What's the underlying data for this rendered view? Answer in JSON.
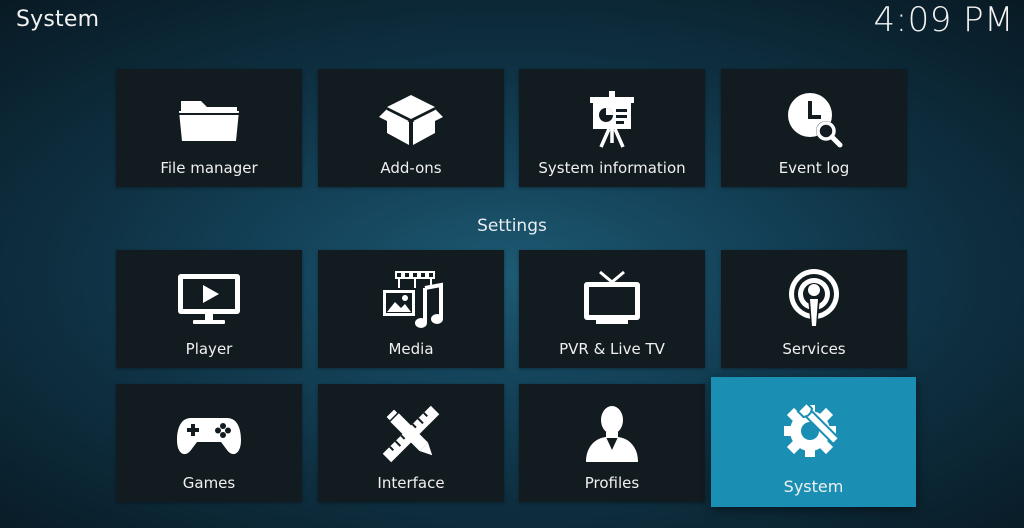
{
  "window": {
    "title": "System"
  },
  "clock": {
    "time": "4:09 PM"
  },
  "top_tiles": [
    {
      "label": "File manager",
      "icon": "folder-icon"
    },
    {
      "label": "Add-ons",
      "icon": "open-box-icon"
    },
    {
      "label": "System information",
      "icon": "presentation-easel-icon"
    },
    {
      "label": "Event log",
      "icon": "clock-search-icon"
    }
  ],
  "settings": {
    "heading": "Settings",
    "tiles": [
      {
        "label": "Player",
        "icon": "monitor-play-icon"
      },
      {
        "label": "Media",
        "icon": "media-library-icon"
      },
      {
        "label": "PVR & Live TV",
        "icon": "tv-antenna-icon"
      },
      {
        "label": "Services",
        "icon": "podcast-broadcast-icon"
      },
      {
        "label": "Games",
        "icon": "gamepad-icon"
      },
      {
        "label": "Interface",
        "icon": "pencil-ruler-icon"
      },
      {
        "label": "Profiles",
        "icon": "user-silhouette-icon"
      },
      {
        "label": "System",
        "icon": "gear-wrench-icon",
        "focused": true
      }
    ]
  },
  "colors": {
    "focus_accent": "#1a8fb3",
    "tile_background": "#121b20",
    "background_center": "#1d5a73",
    "background_edge": "#081a24"
  }
}
